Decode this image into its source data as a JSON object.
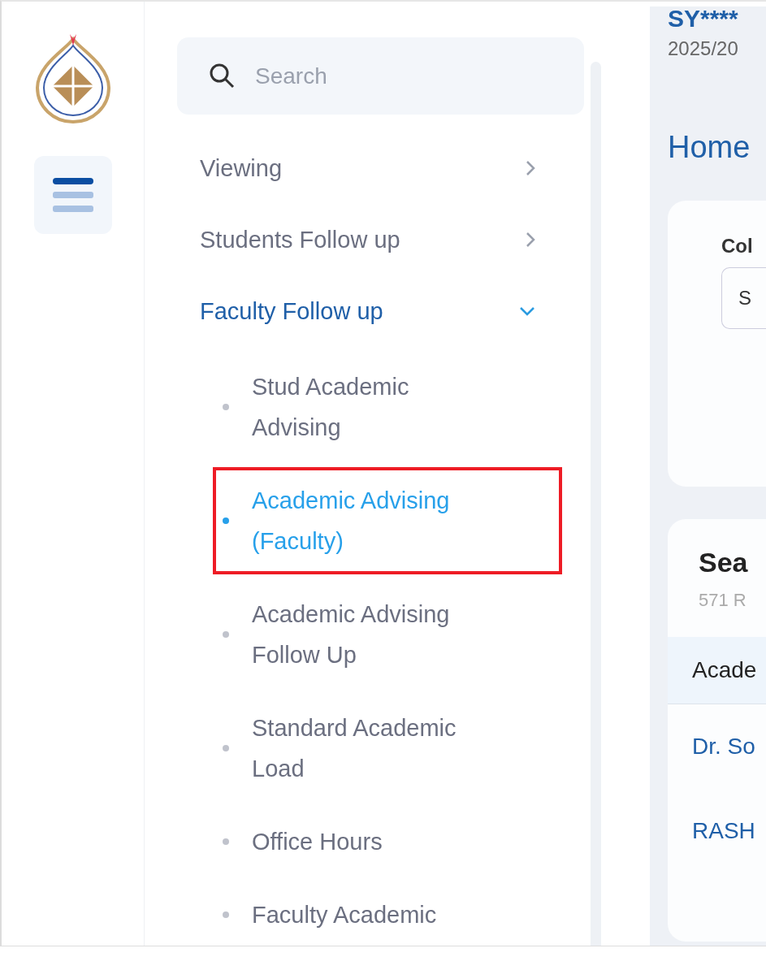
{
  "search": {
    "placeholder": "Search"
  },
  "nav": [
    {
      "label": "Viewing",
      "expanded": false
    },
    {
      "label": "Students Follow up",
      "expanded": false
    },
    {
      "label": "Faculty Follow up",
      "expanded": true,
      "children": [
        {
          "label": "Stud Academic Advising",
          "selected": false,
          "highlighted": false
        },
        {
          "label": "Academic Advising (Faculty)",
          "selected": true,
          "highlighted": true
        },
        {
          "label": "Academic Advising Follow Up",
          "selected": false,
          "highlighted": false
        },
        {
          "label": "Standard Academic Load",
          "selected": false,
          "highlighted": false
        },
        {
          "label": "Office Hours",
          "selected": false,
          "highlighted": false
        },
        {
          "label": "Faculty Academic",
          "selected": false,
          "highlighted": false
        }
      ]
    }
  ],
  "content": {
    "user": "SY****",
    "year": "2025/20",
    "page_title": "Home",
    "filter_label": "Col",
    "filter_value": "S",
    "results_title": "Sea",
    "results_count": "571 R",
    "table": {
      "columns": [
        "Acade"
      ],
      "rows": [
        [
          "Dr. So"
        ],
        [
          "RASH"
        ]
      ]
    }
  }
}
